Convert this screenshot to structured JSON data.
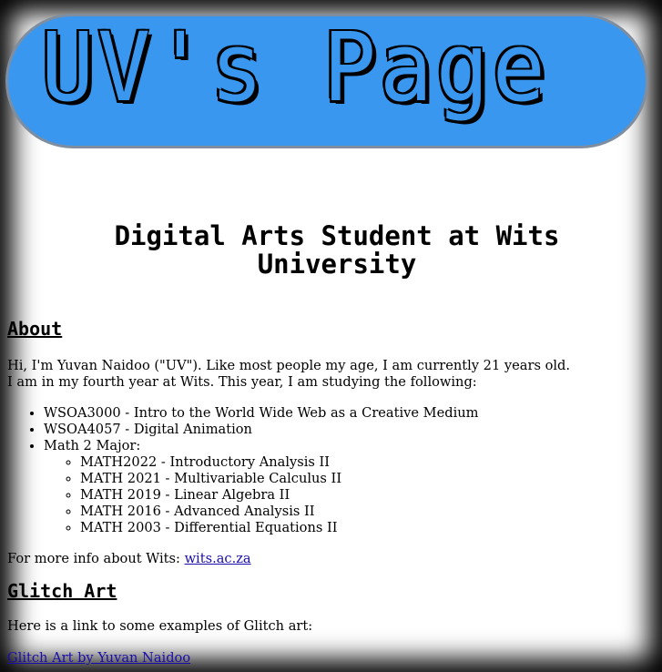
{
  "banner": {
    "title": "UV's Page"
  },
  "subtitle": "Digital Arts Student at Wits University",
  "about": {
    "heading": "About",
    "line1": "Hi, I'm Yuvan Naidoo (\"UV\"). Like most people my age, I am currently 21 years old.",
    "line2": "I am in my fourth year at Wits. This year, I am studying the following:",
    "courses": [
      "WSOA3000 - Intro to the World Wide Web as a Creative Medium",
      "WSOA4057 - Digital Animation",
      "Math 2 Major:"
    ],
    "math_courses": [
      "MATH2022 - Introductory Analysis II",
      "MATH 2021 - Multivariable Calculus II",
      "MATH 2019 - Linear Algebra II",
      "MATH 2016 - Advanced Analysis II",
      "MATH 2003 - Differential Equations II"
    ],
    "more_info_text": "For more info about Wits: ",
    "more_info_link": "wits.ac.za"
  },
  "glitch": {
    "heading": "Glitch Art",
    "intro": "Here is a link to some examples of Glitch art:",
    "link": "Glitch Art by Yuvan Naidoo"
  },
  "colors": {
    "banner": "#3a97ef",
    "banner_border": "#7e8ea0",
    "link": "#1a0dab"
  }
}
